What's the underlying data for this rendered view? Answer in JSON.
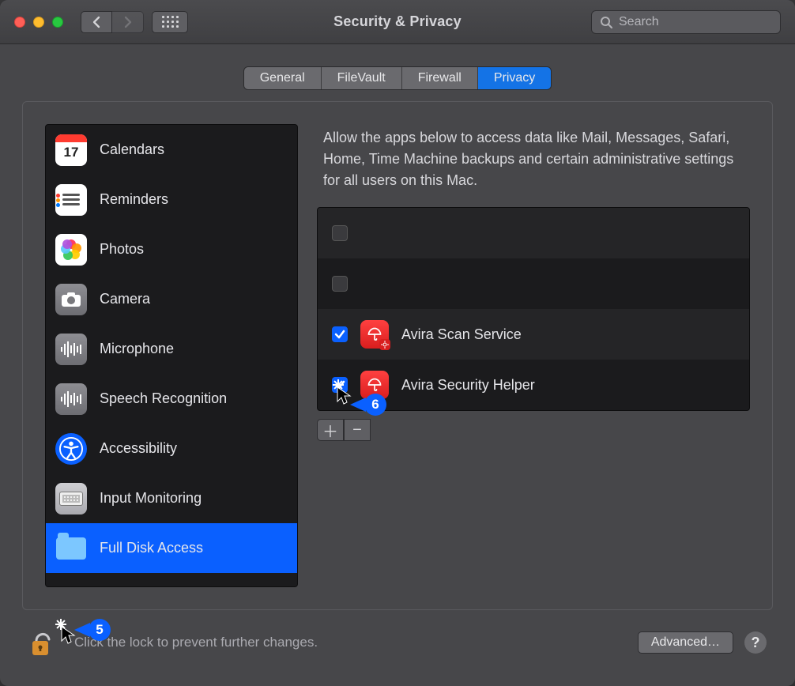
{
  "window_title": "Security & Privacy",
  "search": {
    "placeholder": "Search"
  },
  "tabs": [
    {
      "label": "General",
      "active": false
    },
    {
      "label": "FileVault",
      "active": false
    },
    {
      "label": "Firewall",
      "active": false
    },
    {
      "label": "Privacy",
      "active": true
    }
  ],
  "sidebar": {
    "items": [
      {
        "label": "Calendars",
        "icon": "calendar",
        "day": "17"
      },
      {
        "label": "Reminders",
        "icon": "reminders"
      },
      {
        "label": "Photos",
        "icon": "photos"
      },
      {
        "label": "Camera",
        "icon": "camera"
      },
      {
        "label": "Microphone",
        "icon": "microphone"
      },
      {
        "label": "Speech Recognition",
        "icon": "speech"
      },
      {
        "label": "Accessibility",
        "icon": "accessibility"
      },
      {
        "label": "Input Monitoring",
        "icon": "keyboard"
      },
      {
        "label": "Full Disk Access",
        "icon": "folder",
        "selected": true
      }
    ]
  },
  "description": "Allow the apps below to access data like Mail, Messages, Safari, Home, Time Machine backups and certain administrative settings for all users on this Mac.",
  "apps": [
    {
      "name": "",
      "checked": false,
      "hidden_icon": true
    },
    {
      "name": "",
      "checked": false,
      "hidden_icon": true
    },
    {
      "name": "Avira Scan Service",
      "checked": true,
      "cog": true
    },
    {
      "name": "Avira Security Helper",
      "checked": true,
      "cog": false
    }
  ],
  "footer": {
    "lock_text": "Click the lock to prevent further changes.",
    "advanced_label": "Advanced…",
    "help_label": "?"
  },
  "callouts": {
    "step5": "5",
    "step6": "6"
  }
}
